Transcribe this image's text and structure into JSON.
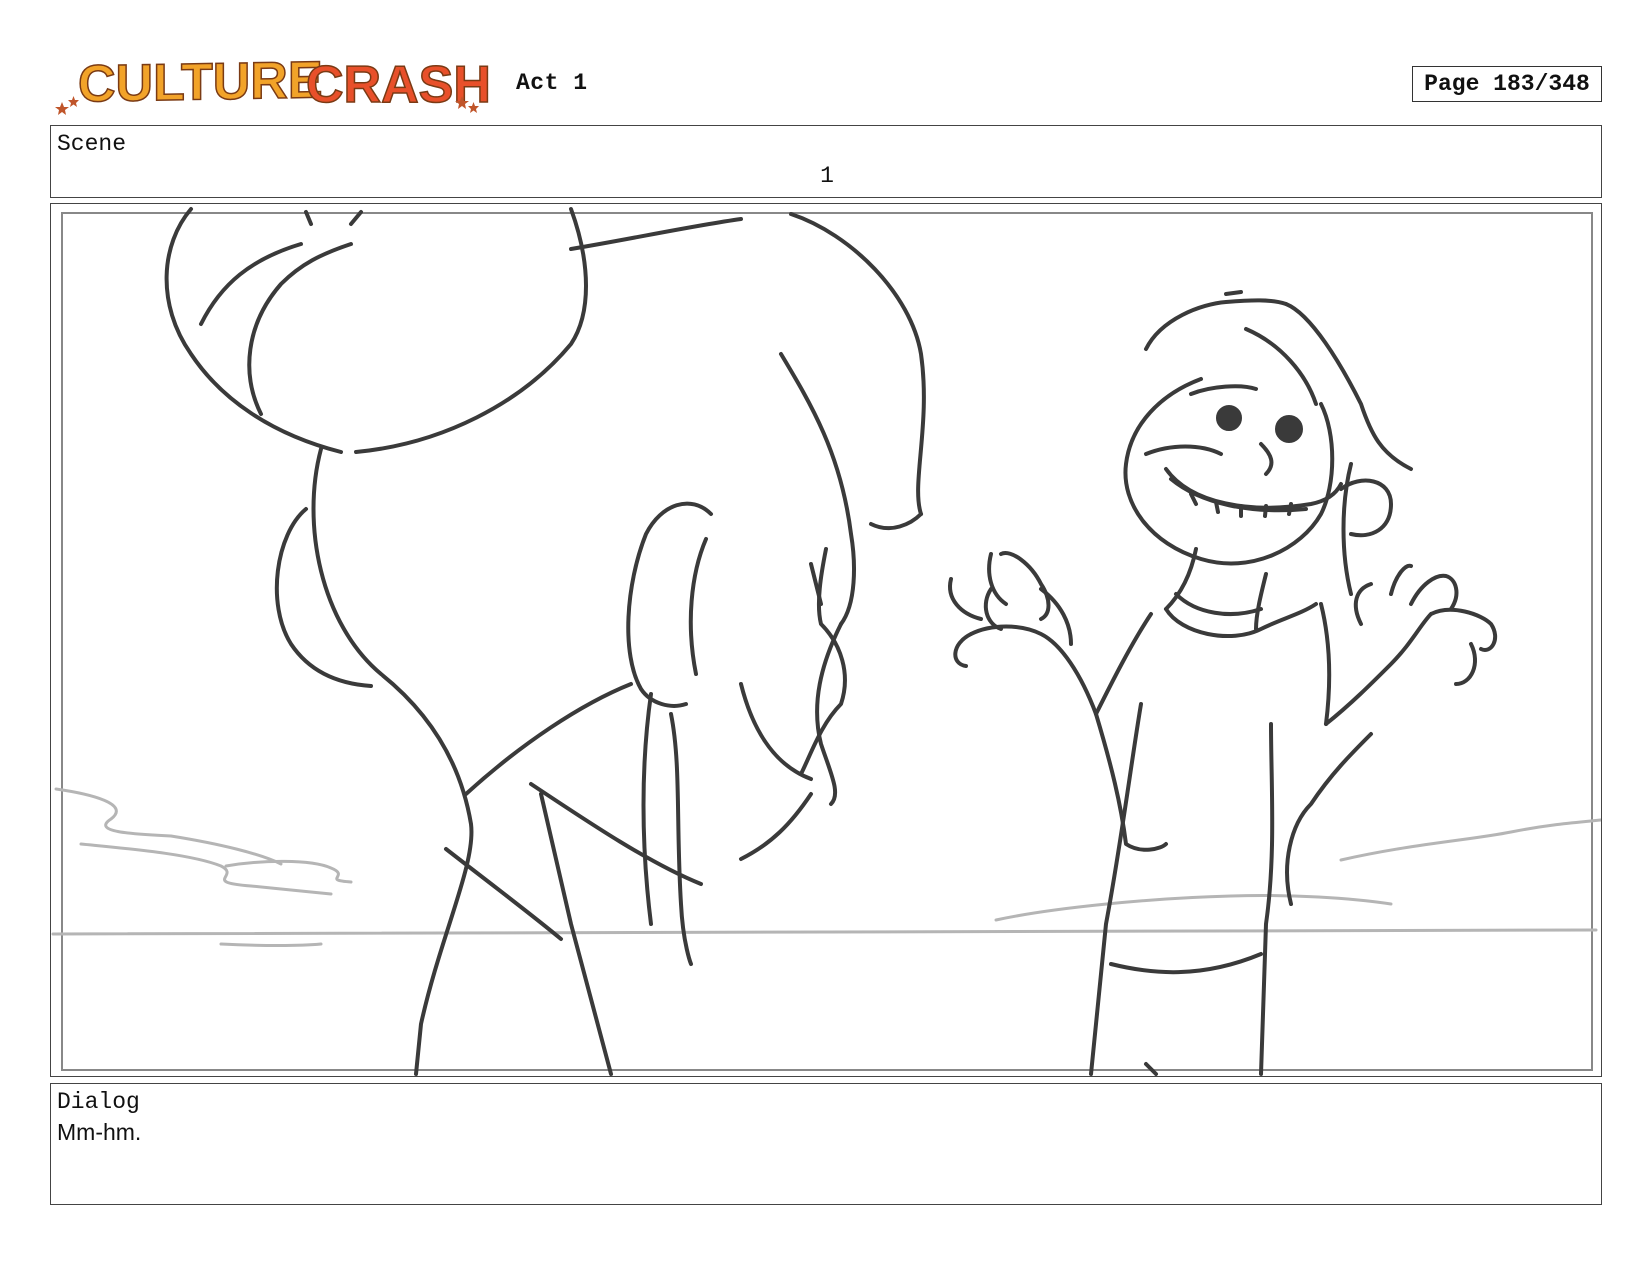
{
  "header": {
    "logo_text": "CULTURE CRASH",
    "act": "Act 1",
    "page": "Page 183/348"
  },
  "scene": {
    "label": "Scene",
    "number": "1"
  },
  "dialog": {
    "label": "Dialog",
    "text": "Mm-hm."
  },
  "colors": {
    "logo_culture": "#f2a329",
    "logo_crash": "#e8502a",
    "logo_outline": "#7a3a14",
    "sketch_line": "#3a3a3a",
    "sketch_light": "#b5b5b5",
    "frame_border": "#444444"
  }
}
